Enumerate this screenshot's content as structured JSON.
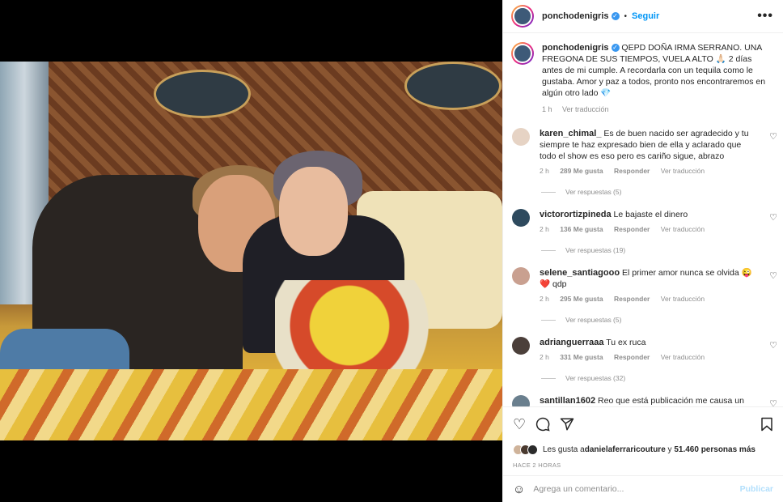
{
  "post": {
    "username": "ponchodenigris",
    "follow_label": "Seguir",
    "more_label": "•••",
    "caption": "QEPD DOÑA IRMA SERRANO. UNA FREGONA DE SUS TIEMPOS, VUELA ALTO 🙏🏻 2 días antes de mi cumple. A recordarla con un tequila como le gustaba. Amor y paz a todos, pronto nos encontraremos en algún otro lado 💎",
    "caption_time": "1 h",
    "caption_translate": "Ver traducción"
  },
  "comments": [
    {
      "user": "karen_chimal_",
      "text": "Es de buen nacido ser agradecido y tu siempre te haz expresado bien de ella y aclarado que todo el show es eso pero es cariño sigue, abrazo",
      "time": "2 h",
      "likes": "289 Me gusta",
      "reply": "Responder",
      "translate": "Ver traducción",
      "replies": "Ver respuestas (5)"
    },
    {
      "user": "victorortizpineda",
      "text": "Le bajaste el dinero",
      "time": "2 h",
      "likes": "136 Me gusta",
      "reply": "Responder",
      "translate": "Ver traducción",
      "replies": "Ver respuestas (19)"
    },
    {
      "user": "selene_santiagooo",
      "text": "El primer amor nunca se olvida 😜 ❤️ qdp",
      "time": "2 h",
      "likes": "295 Me gusta",
      "reply": "Responder",
      "translate": "Ver traducción",
      "replies": "Ver respuestas (5)"
    },
    {
      "user": "adrianguerraaa",
      "text": "Tu ex ruca",
      "time": "2 h",
      "likes": "331 Me gusta",
      "reply": "Responder",
      "translate": "Ver traducción",
      "replies": "Ver respuestas (32)"
    },
    {
      "user": "santillan1602",
      "text": "Reo que está publicación me causa un poco de estrés o no se que 😅 por qué apenas vi una entrevista donde él se burlaba de ella y habló pestes y de repente veo este y digo qué onda ?? Sigo a poncho por qué me gusta pero esto no se cómo sentirme jajaja",
      "time": "",
      "likes": "",
      "reply": "",
      "translate": "",
      "replies": ""
    }
  ],
  "likes_line": {
    "prefix": "Les gusta a ",
    "user": "danielaferraricouture",
    "middle": " y ",
    "count": "51.460 personas más"
  },
  "post_date": "HACE 2 HORAS",
  "add_comment": {
    "placeholder": "Agrega un comentario...",
    "post_label": "Publicar"
  },
  "icons": {
    "like": "heart-icon",
    "comment": "comment-icon",
    "share": "share-icon",
    "save": "bookmark-icon",
    "emoji": "emoji-icon"
  },
  "colors": {
    "link_blue": "#0095f6",
    "muted": "#8e8e8e",
    "border": "#efefef"
  }
}
